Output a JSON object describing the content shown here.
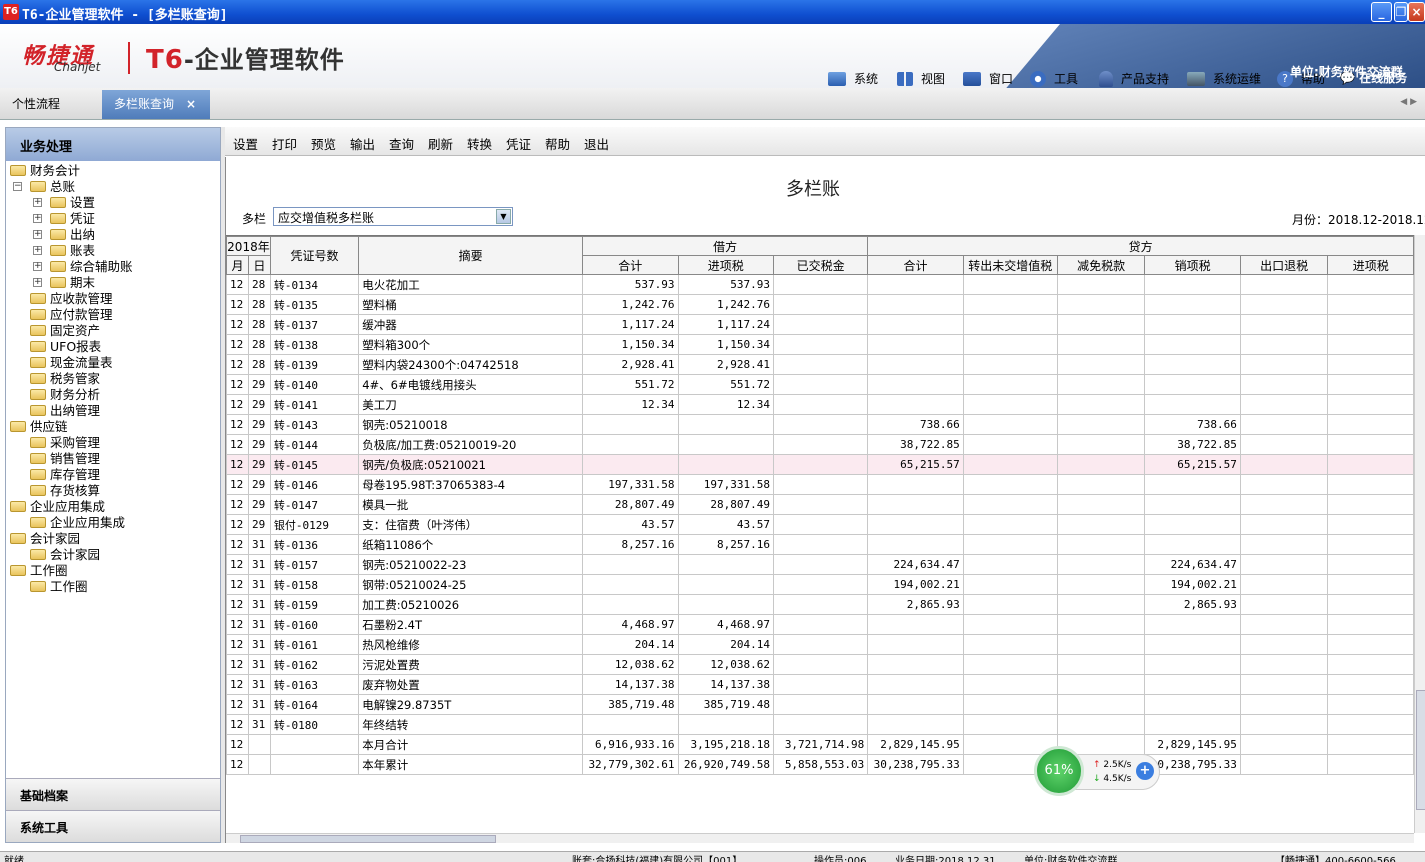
{
  "window": {
    "title": "T6-企业管理软件 - [多栏账查询]",
    "app_icon": "T6"
  },
  "banner": {
    "logo_cn": "畅捷通",
    "logo_en": "Chanjet",
    "product_t6": "T6",
    "product_rest": "-企业管理软件",
    "menu": [
      "系统",
      "视图",
      "窗口",
      "工具",
      "产品支持",
      "系统运维",
      "帮助"
    ],
    "online_service": "在线服务",
    "org": "单位:财务软件交流群"
  },
  "tabs": [
    {
      "label": "个性流程",
      "active": false
    },
    {
      "label": "多栏账查询",
      "active": true,
      "close": "×"
    }
  ],
  "sidebar": {
    "header": "业务处理",
    "tree": [
      {
        "label": "财务会计",
        "level": 0,
        "toggle": ""
      },
      {
        "label": "总账",
        "level": 1,
        "toggle": "−"
      },
      {
        "label": "设置",
        "level": 2,
        "toggle": "+"
      },
      {
        "label": "凭证",
        "level": 2,
        "toggle": "+"
      },
      {
        "label": "出纳",
        "level": 2,
        "toggle": "+"
      },
      {
        "label": "账表",
        "level": 2,
        "toggle": "+"
      },
      {
        "label": "综合辅助账",
        "level": 2,
        "toggle": "+"
      },
      {
        "label": "期末",
        "level": 2,
        "toggle": "+"
      },
      {
        "label": "应收款管理",
        "level": 1,
        "toggle": ""
      },
      {
        "label": "应付款管理",
        "level": 1,
        "toggle": ""
      },
      {
        "label": "固定资产",
        "level": 1,
        "toggle": ""
      },
      {
        "label": "UFO报表",
        "level": 1,
        "toggle": ""
      },
      {
        "label": "现金流量表",
        "level": 1,
        "toggle": ""
      },
      {
        "label": "税务管家",
        "level": 1,
        "toggle": ""
      },
      {
        "label": "财务分析",
        "level": 1,
        "toggle": ""
      },
      {
        "label": "出纳管理",
        "level": 1,
        "toggle": ""
      },
      {
        "label": "供应链",
        "level": 0,
        "toggle": ""
      },
      {
        "label": "采购管理",
        "level": 1,
        "toggle": ""
      },
      {
        "label": "销售管理",
        "level": 1,
        "toggle": ""
      },
      {
        "label": "库存管理",
        "level": 1,
        "toggle": ""
      },
      {
        "label": "存货核算",
        "level": 1,
        "toggle": ""
      },
      {
        "label": "企业应用集成",
        "level": 0,
        "toggle": ""
      },
      {
        "label": "企业应用集成",
        "level": 1,
        "toggle": ""
      },
      {
        "label": "会计家园",
        "level": 0,
        "toggle": ""
      },
      {
        "label": "会计家园",
        "level": 1,
        "toggle": ""
      },
      {
        "label": "工作圈",
        "level": 0,
        "toggle": ""
      },
      {
        "label": "工作圈",
        "level": 1,
        "toggle": ""
      }
    ],
    "footer": [
      "基础档案",
      "系统工具"
    ]
  },
  "toolbar": [
    "设置",
    "打印",
    "预览",
    "输出",
    "查询",
    "刷新",
    "转换",
    "凭证",
    "帮助",
    "退出"
  ],
  "report": {
    "title": "多栏账",
    "dd_label": "多栏",
    "dd_value": "应交增值税多栏账",
    "month_range": "月份：2018.12-2018.12",
    "year": "2018年",
    "h_month": "月",
    "h_day": "日",
    "h_voucher": "凭证号数",
    "h_summary": "摘要",
    "h_debit": "借方",
    "h_credit": "贷方",
    "sub_headers": [
      "合计",
      "进项税",
      "已交税金",
      "合计",
      "转出未交增值税",
      "减免税款",
      "销项税",
      "出口退税",
      "进项税"
    ],
    "rows": [
      {
        "m": "12",
        "d": "28",
        "v": "转-0134",
        "s": "电火花加工",
        "c": [
          "537.93",
          "537.93",
          "",
          "",
          "",
          "",
          "",
          "",
          ""
        ]
      },
      {
        "m": "12",
        "d": "28",
        "v": "转-0135",
        "s": "塑料桶",
        "c": [
          "1,242.76",
          "1,242.76",
          "",
          "",
          "",
          "",
          "",
          "",
          ""
        ]
      },
      {
        "m": "12",
        "d": "28",
        "v": "转-0137",
        "s": "缓冲器",
        "c": [
          "1,117.24",
          "1,117.24",
          "",
          "",
          "",
          "",
          "",
          "",
          ""
        ]
      },
      {
        "m": "12",
        "d": "28",
        "v": "转-0138",
        "s": "塑料箱300个",
        "c": [
          "1,150.34",
          "1,150.34",
          "",
          "",
          "",
          "",
          "",
          "",
          ""
        ]
      },
      {
        "m": "12",
        "d": "28",
        "v": "转-0139",
        "s": "塑料内袋24300个:04742518",
        "c": [
          "2,928.41",
          "2,928.41",
          "",
          "",
          "",
          "",
          "",
          "",
          ""
        ]
      },
      {
        "m": "12",
        "d": "29",
        "v": "转-0140",
        "s": "4#、6#电镀线用接头",
        "c": [
          "551.72",
          "551.72",
          "",
          "",
          "",
          "",
          "",
          "",
          ""
        ]
      },
      {
        "m": "12",
        "d": "29",
        "v": "转-0141",
        "s": "美工刀",
        "c": [
          "12.34",
          "12.34",
          "",
          "",
          "",
          "",
          "",
          "",
          ""
        ]
      },
      {
        "m": "12",
        "d": "29",
        "v": "转-0143",
        "s": "钢壳:05210018",
        "c": [
          "",
          "",
          "",
          "738.66",
          "",
          "",
          "738.66",
          "",
          ""
        ]
      },
      {
        "m": "12",
        "d": "29",
        "v": "转-0144",
        "s": "负极底/加工费:05210019-20",
        "c": [
          "",
          "",
          "",
          "38,722.85",
          "",
          "",
          "38,722.85",
          "",
          ""
        ]
      },
      {
        "m": "12",
        "d": "29",
        "v": "转-0145",
        "s": "钢壳/负极底:05210021",
        "c": [
          "",
          "",
          "",
          "65,215.57",
          "",
          "",
          "65,215.57",
          "",
          ""
        ],
        "hl": true
      },
      {
        "m": "12",
        "d": "29",
        "v": "转-0146",
        "s": "母卷195.98T:37065383-4",
        "c": [
          "197,331.58",
          "197,331.58",
          "",
          "",
          "",
          "",
          "",
          "",
          ""
        ]
      },
      {
        "m": "12",
        "d": "29",
        "v": "转-0147",
        "s": "模具一批",
        "c": [
          "28,807.49",
          "28,807.49",
          "",
          "",
          "",
          "",
          "",
          "",
          ""
        ]
      },
      {
        "m": "12",
        "d": "29",
        "v": "银付-0129",
        "s": "支：住宿费（叶涔伟）",
        "c": [
          "43.57",
          "43.57",
          "",
          "",
          "",
          "",
          "",
          "",
          ""
        ]
      },
      {
        "m": "12",
        "d": "31",
        "v": "转-0136",
        "s": "纸箱11086个",
        "c": [
          "8,257.16",
          "8,257.16",
          "",
          "",
          "",
          "",
          "",
          "",
          ""
        ]
      },
      {
        "m": "12",
        "d": "31",
        "v": "转-0157",
        "s": "钢壳:05210022-23",
        "c": [
          "",
          "",
          "",
          "224,634.47",
          "",
          "",
          "224,634.47",
          "",
          ""
        ]
      },
      {
        "m": "12",
        "d": "31",
        "v": "转-0158",
        "s": "钢带:05210024-25",
        "c": [
          "",
          "",
          "",
          "194,002.21",
          "",
          "",
          "194,002.21",
          "",
          ""
        ]
      },
      {
        "m": "12",
        "d": "31",
        "v": "转-0159",
        "s": "加工费:05210026",
        "c": [
          "",
          "",
          "",
          "2,865.93",
          "",
          "",
          "2,865.93",
          "",
          ""
        ]
      },
      {
        "m": "12",
        "d": "31",
        "v": "转-0160",
        "s": "石墨粉2.4T",
        "c": [
          "4,468.97",
          "4,468.97",
          "",
          "",
          "",
          "",
          "",
          "",
          ""
        ]
      },
      {
        "m": "12",
        "d": "31",
        "v": "转-0161",
        "s": "热风枪维修",
        "c": [
          "204.14",
          "204.14",
          "",
          "",
          "",
          "",
          "",
          "",
          ""
        ]
      },
      {
        "m": "12",
        "d": "31",
        "v": "转-0162",
        "s": "污泥处置费",
        "c": [
          "12,038.62",
          "12,038.62",
          "",
          "",
          "",
          "",
          "",
          "",
          ""
        ]
      },
      {
        "m": "12",
        "d": "31",
        "v": "转-0163",
        "s": "废弃物处置",
        "c": [
          "14,137.38",
          "14,137.38",
          "",
          "",
          "",
          "",
          "",
          "",
          ""
        ]
      },
      {
        "m": "12",
        "d": "31",
        "v": "转-0164",
        "s": "电解镍29.8735T",
        "c": [
          "385,719.48",
          "385,719.48",
          "",
          "",
          "",
          "",
          "",
          "",
          ""
        ]
      },
      {
        "m": "12",
        "d": "31",
        "v": "转-0180",
        "s": "年终结转",
        "c": [
          "",
          "",
          "",
          "",
          "",
          "",
          "",
          "",
          ""
        ]
      },
      {
        "m": "12",
        "d": "",
        "v": "",
        "s": "本月合计",
        "c": [
          "6,916,933.16",
          "3,195,218.18",
          "3,721,714.98",
          "2,829,145.95",
          "",
          "",
          "2,829,145.95",
          "",
          ""
        ]
      },
      {
        "m": "12",
        "d": "",
        "v": "",
        "s": "本年累计",
        "c": [
          "32,779,302.61",
          "26,920,749.58",
          "5,858,553.03",
          "30,238,795.33",
          "",
          "",
          "30,238,795.33",
          "",
          ""
        ]
      }
    ]
  },
  "netwidget": {
    "percent": "61%",
    "up": "2.5K/s",
    "down": "4.5K/s"
  },
  "statusbar": {
    "ready": "就绪",
    "account": "账套:合扬科技(福建)有限公司【001】",
    "operator": "操作员:006",
    "biz_date": "业务日期:2018.12.31",
    "unit": "单位:财务软件交流群",
    "hotline": "【畅捷通】400-6600-566"
  },
  "colors": {
    "title_bar": "#0f4fd0",
    "brand_red": "#d2232a",
    "tab_active": "#4f7cba",
    "row_highlight": "#fbeaf0"
  }
}
